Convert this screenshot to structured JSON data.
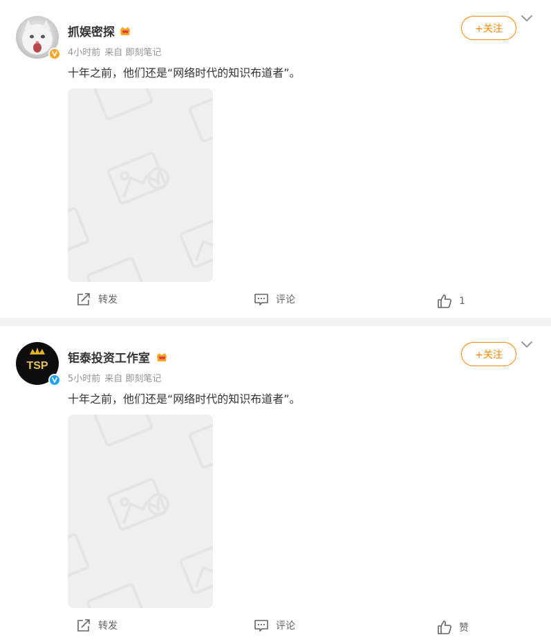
{
  "posts": [
    {
      "author": "抓娱密探",
      "time": "4小时前",
      "source": "来自 即刻笔记",
      "text": "十年之前，他们还是“网络时代的知识布道者”。",
      "follow_label": "+关注",
      "avatar_icon": "white-kitten-avatar",
      "verified_color": "#f5a623",
      "actions": {
        "repost_label": "转发",
        "comment_label": "评论",
        "like_label": "1"
      }
    },
    {
      "author": "钜泰投资工作室",
      "time": "5小时前",
      "source": "来自 即刻笔记",
      "text": "十年之前，他们还是“网络时代的知识布道者”。",
      "follow_label": "+关注",
      "avatar_icon": "tsp-crown-logo",
      "avatar_text": "TSP",
      "verified_color": "#1da1f2",
      "actions": {
        "repost_label": "转发",
        "comment_label": "评论",
        "like_label": "赞"
      }
    }
  ],
  "colors": {
    "accent": "#ff8200",
    "divider": "#f2f2f2",
    "placeholder": "#efefef"
  }
}
